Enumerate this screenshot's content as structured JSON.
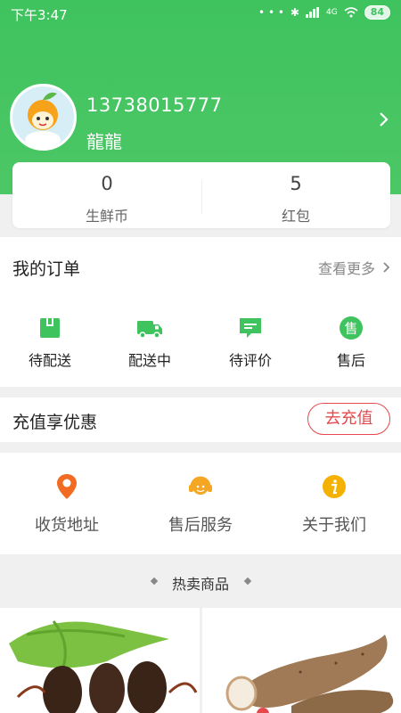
{
  "status_bar": {
    "time": "下午3:47",
    "battery": "84",
    "network": "4G"
  },
  "profile": {
    "phone": "13738015777",
    "nickname": "龍龍"
  },
  "stats": [
    {
      "value": "0",
      "label": "生鲜币"
    },
    {
      "value": "5",
      "label": "红包"
    }
  ],
  "orders": {
    "title": "我的订单",
    "more": "查看更多",
    "items": [
      {
        "label": "待配送",
        "icon": "box-icon"
      },
      {
        "label": "配送中",
        "icon": "truck-icon"
      },
      {
        "label": "待评价",
        "icon": "comment-icon"
      },
      {
        "label": "售后",
        "icon": "after-sale-icon"
      }
    ]
  },
  "recharge": {
    "title": "充值享优惠",
    "button": "去充值"
  },
  "services": [
    {
      "label": "收货地址",
      "icon": "location-pin-icon"
    },
    {
      "label": "售后服务",
      "icon": "headset-icon"
    },
    {
      "label": "关于我们",
      "icon": "info-icon"
    }
  ],
  "hot": {
    "title": "热卖商品"
  },
  "colors": {
    "brand_green": "#3fc35e",
    "accent_red": "#e5484d",
    "service_orange": "#f5a623"
  }
}
